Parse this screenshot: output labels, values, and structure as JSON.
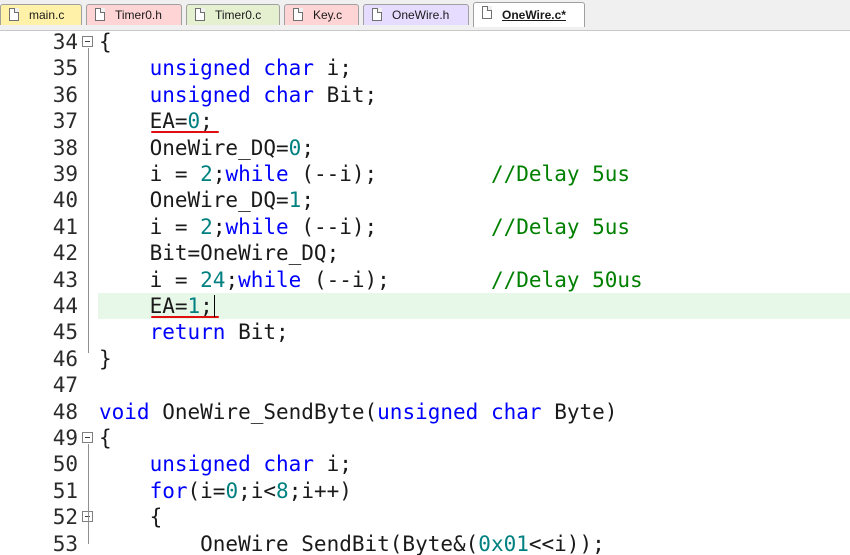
{
  "tabs": [
    {
      "label": "main.c",
      "color": "#fff2a8",
      "active": false
    },
    {
      "label": "Timer0.h",
      "color": "#ffd4d4",
      "active": false
    },
    {
      "label": "Timer0.c",
      "color": "#e4f0d0",
      "active": false
    },
    {
      "label": "Key.c",
      "color": "#ffd4d4",
      "active": false
    },
    {
      "label": "OneWire.h",
      "color": "#e6dcff",
      "active": false
    },
    {
      "label": "OneWire.c*",
      "color": "#ffffff",
      "active": true
    }
  ],
  "editor": {
    "current_line": 44,
    "lines": [
      {
        "n": "34",
        "fold": "minus",
        "text": "{"
      },
      {
        "n": "35",
        "text": "    unsigned char i;"
      },
      {
        "n": "36",
        "text": "    unsigned char Bit;"
      },
      {
        "n": "37",
        "text": "    EA=0;",
        "underline": true
      },
      {
        "n": "38",
        "text": "    OneWire_DQ=0;"
      },
      {
        "n": "39",
        "text": "    i = 2;while (--i);         //Delay 5us"
      },
      {
        "n": "40",
        "text": "    OneWire_DQ=1;"
      },
      {
        "n": "41",
        "text": "    i = 2;while (--i);         //Delay 5us"
      },
      {
        "n": "42",
        "text": "    Bit=OneWire_DQ;"
      },
      {
        "n": "43",
        "text": "    i = 24;while (--i);        //Delay 50us"
      },
      {
        "n": "44",
        "text": "    EA=1;",
        "underline": true,
        "caret": true
      },
      {
        "n": "45",
        "text": "    return Bit;"
      },
      {
        "n": "46",
        "text": "}"
      },
      {
        "n": "47",
        "text": ""
      },
      {
        "n": "48",
        "text": "void OneWire_SendByte(unsigned char Byte)"
      },
      {
        "n": "49",
        "fold": "minus",
        "text": "{"
      },
      {
        "n": "50",
        "text": "    unsigned char i;"
      },
      {
        "n": "51",
        "text": "    for(i=0;i<8;i++)"
      },
      {
        "n": "52",
        "fold": "minus",
        "text": "    {"
      },
      {
        "n": "53",
        "text": "        OneWire_SendBit(Byte&(0x01<<i));"
      }
    ]
  },
  "colors": {
    "keyword": "#0000ff",
    "number": "#008080",
    "comment": "#008000",
    "annotation": "#e01010",
    "current_line_bg": "#e8f8e8"
  }
}
